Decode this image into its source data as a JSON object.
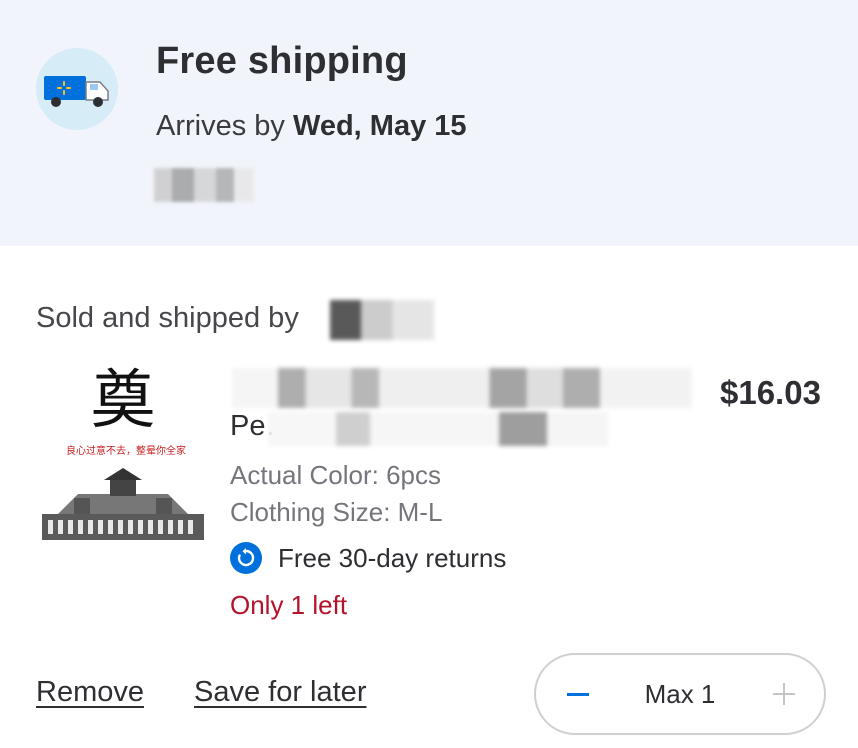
{
  "shipping": {
    "title": "Free shipping",
    "arrives_prefix": "Arrives by ",
    "arrives_date": "Wed, May 15",
    "icon": "delivery-truck-icon"
  },
  "seller": {
    "sold_by_label": "Sold and shipped by "
  },
  "item": {
    "title_line2_visible": "Pe… …n...",
    "price": "$16.03",
    "thumbnail": {
      "big_char": "奠",
      "red_line": "良心过意不去，整晕你全家"
    },
    "attributes": [
      "Actual Color: 6pcs",
      "Clothing Size: M-L"
    ],
    "returns_label": "Free 30-day returns",
    "returns_icon": "return-arrow-icon",
    "stock_label": "Only 1 left"
  },
  "actions": {
    "remove_label": "Remove",
    "save_label": "Save for later",
    "quantity_label": "Max 1",
    "minus_icon": "minus-icon",
    "plus_icon": "plus-icon"
  },
  "colors": {
    "accent_blue": "#0071dc",
    "banner_bg": "#f1f5fb",
    "stock_red": "#b5132b"
  }
}
